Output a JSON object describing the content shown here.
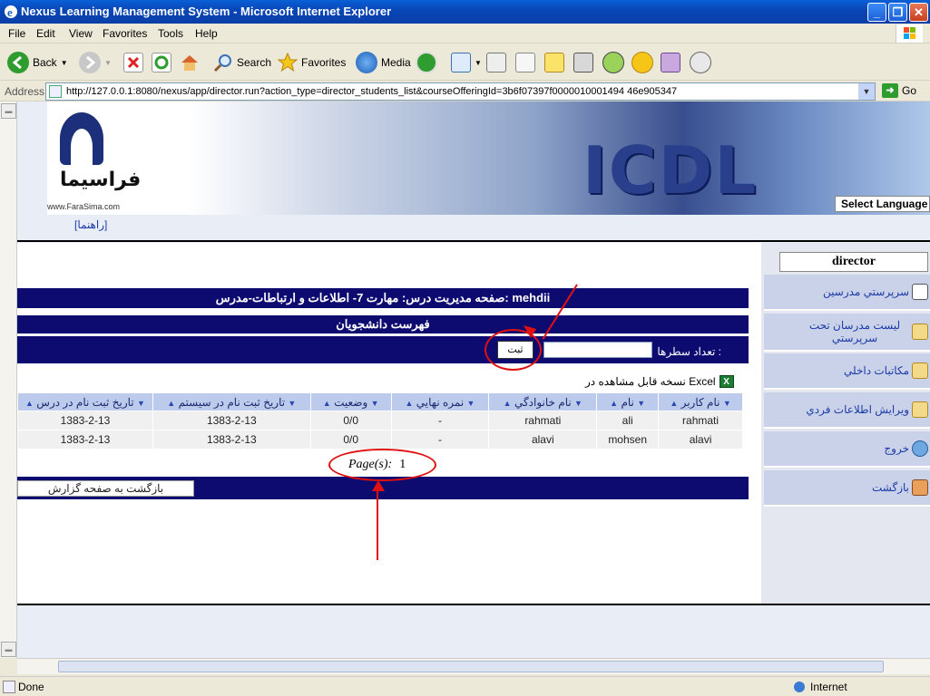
{
  "window": {
    "title": "Nexus Learning Management System - Microsoft Internet Explorer"
  },
  "menu": [
    "File",
    "Edit",
    "View",
    "Favorites",
    "Tools",
    "Help"
  ],
  "toolbar": {
    "back": "Back",
    "search": "Search",
    "favorites": "Favorites",
    "media": "Media"
  },
  "address": {
    "label": "Address",
    "url": "http://127.0.0.1:8080/nexus/app/director.run?action_type=director_students_list&courseOfferingId=3b6f07397f0000010001494 46e905347",
    "go": "Go"
  },
  "banner": {
    "logo_text": "فراسيما",
    "logo_url": "www.FaraSima.com",
    "brand": "ICDL",
    "language_select": "Select Language"
  },
  "help_link": "[راهنما]",
  "content": {
    "course_header": "صفحه مديريت درس: مهارت 7- اطلاعات و ارتباطات-مدرس: mehdii",
    "list_title": "فهرست دانشجويان",
    "rows_label": "تعداد سطرها :",
    "rows_value": "",
    "submit": "ثبت",
    "excel_link": "نسخه قابل مشاهده در Excel",
    "columns": [
      "نام كاربر",
      "نام",
      "نام خانوادگي",
      "نمره نهايي",
      "وضعيت",
      "تاريخ ثبت نام در سيستم",
      "تاريخ ثبت نام در درس"
    ],
    "rows": [
      [
        "rahmati",
        "ali",
        "rahmati",
        "-",
        "0/0",
        "1383-2-13",
        "1383-2-13"
      ],
      [
        "alavi",
        "mohsen",
        "alavi",
        "-",
        "0/0",
        "1383-2-13",
        "1383-2-13"
      ]
    ],
    "pager_label": "Page(s):",
    "pager_value": "1",
    "back_button": "بازگشت به صفحه گزارش"
  },
  "sidebar": {
    "title": "director",
    "items": [
      "سرپرستي مدرسين",
      "ليست مدرسان تحت سرپرستي",
      "مكاتبات داخلي",
      "ويرايش اطلاعات فردي",
      "خروج",
      "بازگشت"
    ]
  },
  "status": {
    "left": "Done",
    "zone": "Internet"
  },
  "colors": {
    "nav_bar": "#0D0B70",
    "header_row": "#BCCBEB",
    "annotation": "#E01010"
  }
}
